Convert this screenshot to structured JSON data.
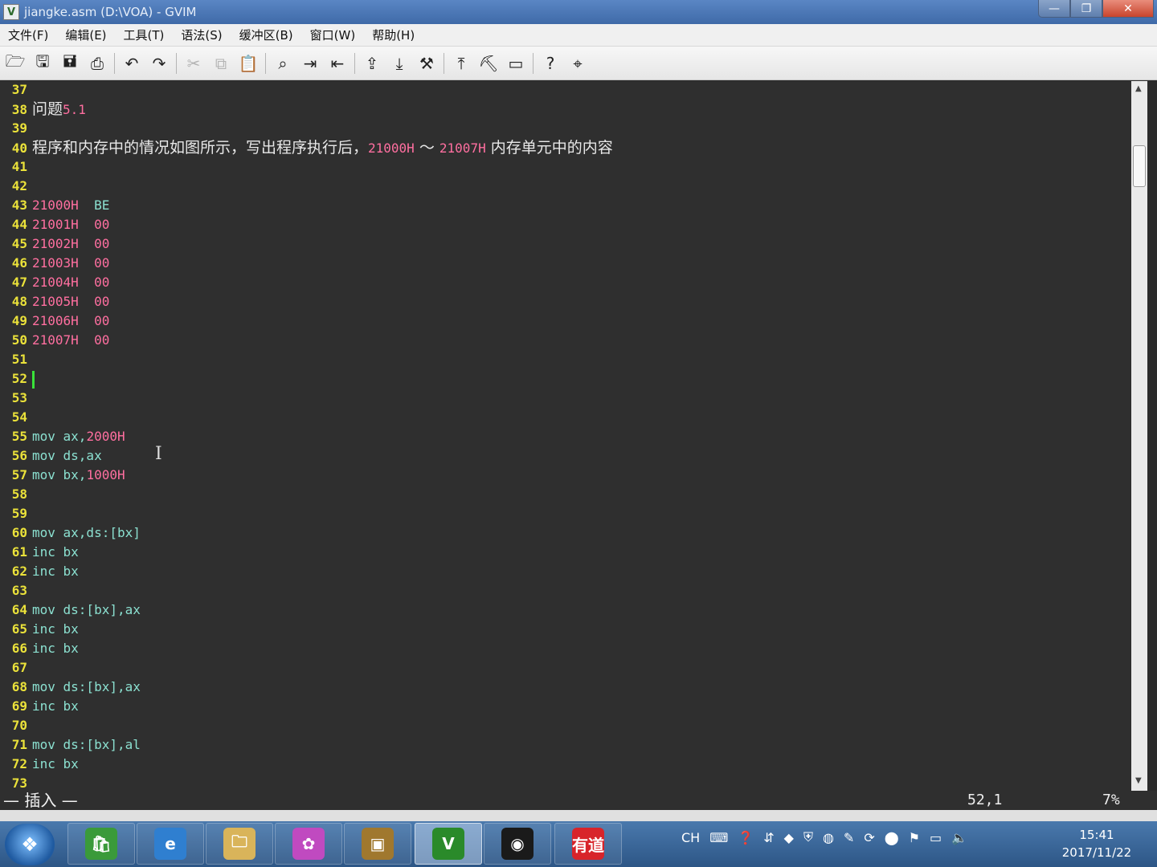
{
  "window": {
    "title": "jiangke.asm (D:\\VOA) - GVIM"
  },
  "menu": [
    "文件(F)",
    "编辑(E)",
    "工具(T)",
    "语法(S)",
    "缓冲区(B)",
    "窗口(W)",
    "帮助(H)"
  ],
  "toolbar": {
    "icons": [
      {
        "name": "open-icon",
        "glyph": "🗁",
        "dim": false
      },
      {
        "name": "save-icon",
        "glyph": "🖫",
        "dim": false
      },
      {
        "name": "save-all-icon",
        "glyph": "🖬",
        "dim": false
      },
      {
        "name": "print-icon",
        "glyph": "⎙",
        "dim": false
      },
      {
        "sep": true
      },
      {
        "name": "undo-icon",
        "glyph": "↶",
        "dim": false
      },
      {
        "name": "redo-icon",
        "glyph": "↷",
        "dim": false
      },
      {
        "sep": true
      },
      {
        "name": "cut-icon",
        "glyph": "✂",
        "dim": true
      },
      {
        "name": "copy-icon",
        "glyph": "⧉",
        "dim": true
      },
      {
        "name": "paste-icon",
        "glyph": "📋",
        "dim": false
      },
      {
        "sep": true
      },
      {
        "name": "find-replace-icon",
        "glyph": "⌕",
        "dim": false
      },
      {
        "name": "find-next-icon",
        "glyph": "⇥",
        "dim": false
      },
      {
        "name": "find-prev-icon",
        "glyph": "⇤",
        "dim": false
      },
      {
        "sep": true
      },
      {
        "name": "load-session-icon",
        "glyph": "⇪",
        "dim": false
      },
      {
        "name": "save-session-icon",
        "glyph": "⤓",
        "dim": false
      },
      {
        "name": "run-script-icon",
        "glyph": "⚒",
        "dim": false
      },
      {
        "sep": true
      },
      {
        "name": "make-icon",
        "glyph": "⤒",
        "dim": false
      },
      {
        "name": "shell-icon",
        "glyph": "⛏",
        "dim": false
      },
      {
        "name": "ctags-icon",
        "glyph": "▭",
        "dim": false
      },
      {
        "sep": true
      },
      {
        "name": "help-icon",
        "glyph": "?",
        "dim": false
      },
      {
        "name": "find-help-icon",
        "glyph": "⌖",
        "dim": false
      }
    ]
  },
  "editor": {
    "lines": [
      {
        "n": "37",
        "segs": []
      },
      {
        "n": "38",
        "segs": [
          {
            "c": "c-text",
            "t": "问题"
          },
          {
            "c": "c-num",
            "t": "5.1"
          }
        ]
      },
      {
        "n": "39",
        "segs": []
      },
      {
        "n": "40",
        "segs": [
          {
            "c": "c-text",
            "t": "程序和内存中的情况如图所示，写出程序执行后，"
          },
          {
            "c": "c-num",
            "t": "21000H"
          },
          {
            "c": "c-text",
            "t": " ～ "
          },
          {
            "c": "c-num",
            "t": "21007H"
          },
          {
            "c": "c-text",
            "t": " 内存单元中的内容"
          }
        ]
      },
      {
        "n": "41",
        "segs": []
      },
      {
        "n": "42",
        "segs": []
      },
      {
        "n": "43",
        "segs": [
          {
            "c": "c-num",
            "t": "21000H  "
          },
          {
            "c": "c-id",
            "t": "BE"
          }
        ]
      },
      {
        "n": "44",
        "segs": [
          {
            "c": "c-num",
            "t": "21001H  00"
          }
        ]
      },
      {
        "n": "45",
        "segs": [
          {
            "c": "c-num",
            "t": "21002H  00"
          }
        ]
      },
      {
        "n": "46",
        "segs": [
          {
            "c": "c-num",
            "t": "21003H  00"
          }
        ]
      },
      {
        "n": "47",
        "segs": [
          {
            "c": "c-num",
            "t": "21004H  00"
          }
        ]
      },
      {
        "n": "48",
        "segs": [
          {
            "c": "c-num",
            "t": "21005H  00"
          }
        ]
      },
      {
        "n": "49",
        "segs": [
          {
            "c": "c-num",
            "t": "21006H  00"
          }
        ]
      },
      {
        "n": "50",
        "segs": [
          {
            "c": "c-num",
            "t": "21007H  00"
          }
        ]
      },
      {
        "n": "51",
        "segs": []
      },
      {
        "n": "52",
        "segs": [],
        "cursor": true
      },
      {
        "n": "53",
        "segs": []
      },
      {
        "n": "54",
        "segs": []
      },
      {
        "n": "55",
        "segs": [
          {
            "c": "c-kw",
            "t": "mov ax,"
          },
          {
            "c": "c-num",
            "t": "2000H"
          }
        ]
      },
      {
        "n": "56",
        "segs": [
          {
            "c": "c-kw",
            "t": "mov ds,ax"
          }
        ]
      },
      {
        "n": "57",
        "segs": [
          {
            "c": "c-kw",
            "t": "mov bx,"
          },
          {
            "c": "c-num",
            "t": "1000H"
          }
        ]
      },
      {
        "n": "58",
        "segs": []
      },
      {
        "n": "59",
        "segs": []
      },
      {
        "n": "60",
        "segs": [
          {
            "c": "c-kw",
            "t": "mov ax,ds:[bx]"
          }
        ]
      },
      {
        "n": "61",
        "segs": [
          {
            "c": "c-kw",
            "t": "inc bx"
          }
        ]
      },
      {
        "n": "62",
        "segs": [
          {
            "c": "c-kw",
            "t": "inc bx"
          }
        ]
      },
      {
        "n": "63",
        "segs": []
      },
      {
        "n": "64",
        "segs": [
          {
            "c": "c-kw",
            "t": "mov ds:[bx],ax"
          }
        ]
      },
      {
        "n": "65",
        "segs": [
          {
            "c": "c-kw",
            "t": "inc bx"
          }
        ]
      },
      {
        "n": "66",
        "segs": [
          {
            "c": "c-kw",
            "t": "inc bx"
          }
        ]
      },
      {
        "n": "67",
        "segs": []
      },
      {
        "n": "68",
        "segs": [
          {
            "c": "c-kw",
            "t": "mov ds:[bx],ax"
          }
        ]
      },
      {
        "n": "69",
        "segs": [
          {
            "c": "c-kw",
            "t": "inc bx"
          }
        ]
      },
      {
        "n": "70",
        "segs": []
      },
      {
        "n": "71",
        "segs": [
          {
            "c": "c-kw",
            "t": "mov ds:[bx],al"
          }
        ]
      },
      {
        "n": "72",
        "segs": [
          {
            "c": "c-kw",
            "t": "inc bx"
          }
        ]
      },
      {
        "n": "73",
        "segs": []
      }
    ]
  },
  "status": {
    "mode": "— 插入 —",
    "position": "52,1",
    "percent": "7%"
  },
  "taskbar": {
    "start_glyph": "❖",
    "tasks": [
      {
        "name": "taskbar-store-icon",
        "glyph": "🛍",
        "bg": "#3a9a3a",
        "active": false
      },
      {
        "name": "taskbar-ie-icon",
        "glyph": "e",
        "bg": "#2f7fd0",
        "active": false
      },
      {
        "name": "taskbar-explorer-icon",
        "glyph": "🗀",
        "bg": "#d9b45a",
        "active": false
      },
      {
        "name": "taskbar-picasa-icon",
        "glyph": "✿",
        "bg": "#c04ac0",
        "active": false
      },
      {
        "name": "taskbar-archive-icon",
        "glyph": "▣",
        "bg": "#a0782e",
        "active": false
      },
      {
        "name": "taskbar-gvim-icon",
        "glyph": "V",
        "bg": "#2a8a2a",
        "active": true
      },
      {
        "name": "taskbar-obs-icon",
        "glyph": "◉",
        "bg": "#1a1a1a",
        "active": false
      },
      {
        "name": "taskbar-youdao-icon",
        "glyph": "有道",
        "bg": "#d8242a",
        "active": false
      }
    ],
    "tray_lang": "CH",
    "clock_time": "15:41",
    "clock_date": "2017/11/22"
  }
}
